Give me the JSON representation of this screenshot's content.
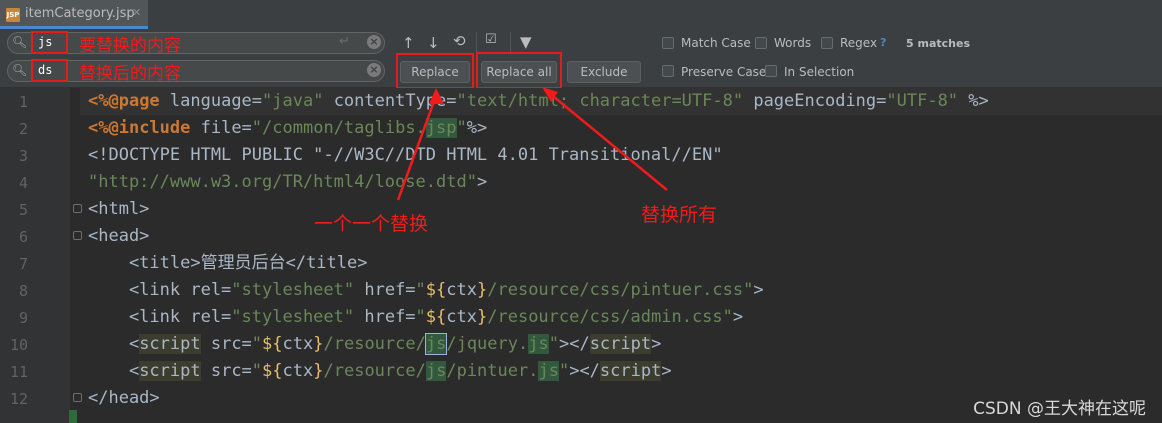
{
  "tab": {
    "filename": "itemCategory.jsp",
    "file_icon_text": "JSP"
  },
  "find": {
    "search_value": "js",
    "replace_value": "ds",
    "search_annotation": "要替换的内容",
    "replace_annotation": "替换后的内容",
    "matches": "5 matches",
    "help": "?"
  },
  "buttons": {
    "replace": "Replace",
    "replace_all": "Replace all",
    "exclude": "Exclude"
  },
  "options": {
    "match_case": "Match Case",
    "words": "Words",
    "regex": "Regex",
    "preserve_case": "Preserve Case",
    "in_selection": "In Selection"
  },
  "icons": {
    "search": "search-icon",
    "replace_search": "search-replace-icon",
    "up": "arrow-up-icon",
    "down": "arrow-down-icon",
    "find_all": "find-all-icon",
    "select_all": "select-occurrences-icon",
    "filter": "filter-icon",
    "clear": "clear-icon",
    "newline": "newline-icon"
  },
  "line_numbers": [
    "1",
    "2",
    "3",
    "4",
    "5",
    "6",
    "7",
    "8",
    "9",
    "10",
    "11",
    "12"
  ],
  "annotations": {
    "one_by_one": "一个一个替换",
    "replace_all": "替换所有"
  },
  "watermark": "CSDN @王大神在这呢",
  "colors": {
    "annotation_red": "#f21b1b",
    "editor_bg": "#2b2b2b",
    "match_highlight": "#32593d"
  }
}
